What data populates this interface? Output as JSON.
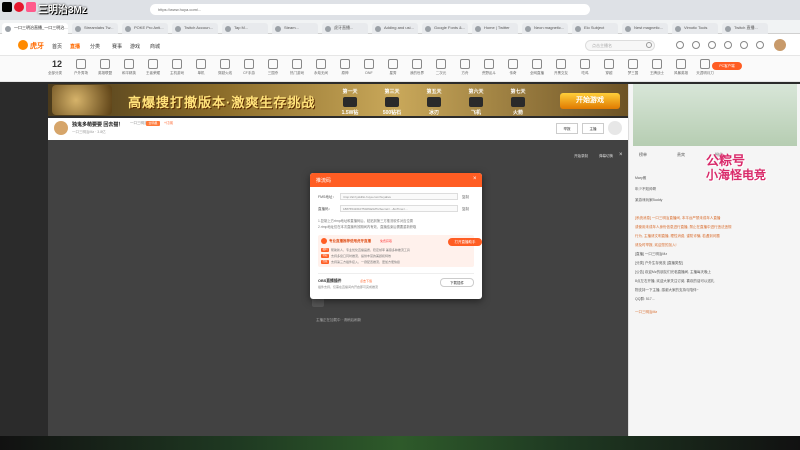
{
  "overlay": {
    "left_title": "三明治3Mz",
    "right_line1": "公粽号",
    "right_line2": "小海怪电竞"
  },
  "browser": {
    "address": "https://www.huya.com/...",
    "tabs": [
      "Streamlabs Tw...",
      "POKE Pro Anti...",
      "Twitch Accoun...",
      "Tap M...",
      "Steam...",
      "虎牙直播...",
      "Adding and usi...",
      "Google Fonts &...",
      "Home | Twitter",
      "Neon magnetic...",
      "Elo Subject",
      "Nest magnetic...",
      "Vimotic Tools",
      "Twitch 直播..."
    ],
    "active_tab": "一口三明治直播_一口三明治..."
  },
  "site_nav": {
    "logo": "虎牙",
    "links": [
      "首页",
      "直播",
      "分类",
      "赛事",
      "游戏",
      "商城"
    ],
    "search_placeholder": "点击主播名",
    "login": "登录"
  },
  "categories": {
    "count_num": "12",
    "count_label": "全部分类",
    "items": [
      "户外秀场",
      "英雄联盟",
      "和平精英",
      "王者荣耀",
      "主机游戏",
      "单机",
      "穿越火线",
      "CF手游",
      "三国杀",
      "热门游戏",
      "永劫无间",
      "原神",
      "DNF",
      "星秀",
      "我的世界",
      "二次元",
      "方舟",
      "荒野乱斗",
      "传奇",
      "全网直播",
      "开黑交友",
      "吃鸡",
      "穿越",
      "梦三国",
      "王牌战士",
      "风暴英雄",
      "天涯明月刀"
    ],
    "pc_badge": "PC客户端"
  },
  "banner": {
    "title": "高爆搜打撤版本·激爽生存挑战",
    "items": [
      "第一天",
      "第三天",
      "第五天",
      "第六天",
      "第七天"
    ],
    "item_labels": [
      "1.5W钻",
      "500钻石",
      "冰刃",
      "飞机",
      "火箭"
    ],
    "cta": "开始游戏"
  },
  "stream": {
    "title": "独鬼多萌要要 回去猫！",
    "host": "一口三明治Mz",
    "badge": "全明星",
    "follow": "+订阅",
    "meta": "一口三明治Mz  · 3.8亿",
    "btn_report": "举报",
    "btn_subscribe": "主播",
    "video_btn1": "开始录制",
    "video_btn2": "弹幕切换",
    "video_close": "×",
    "bottom_text": "主播正在加载中  · 请稍后刷新"
  },
  "modal": {
    "title": "推流码",
    "fields": [
      {
        "label": "FMS地址：",
        "value": "rtmp://al.hyskillto.huya.com/huyalive",
        "copy": "复制"
      },
      {
        "label": "直播码：",
        "value": "188765416107502f3a9d?txSecret=...&txTime=...",
        "copy": "复制"
      }
    ],
    "notes": [
      "1.复制上方rtmp地址和直播码后，粘贴到第三方推流软件对应位置",
      "2.rtmp地址仅在本次直播有效期间内有效，直播结束后需要重新获取"
    ],
    "promo_title": "专业直播推荐使用虎牙直播",
    "promo_hot": "免费获取",
    "promo_lines": [
      "帮助新人，专业优化直播画质，稳定帧率 兼容多种推流工具",
      "支持多窗口同时推流，提供丰富的美颜和特效",
      "支持第三方插件接入，一键配置推流，更加方便快捷"
    ],
    "tags": [
      "福利",
      "特权",
      "性能"
    ],
    "open_btn": "打开直播助手",
    "plugin_title": "OBS直播插件",
    "plugin_hot": "点击下载",
    "plugin_desc": "插件支持，仅需在直播间内开启即可完成推流",
    "download_btn": "下载插件"
  },
  "right_panel": {
    "tabs": [
      "榜单",
      "贵宾",
      "粉丝"
    ],
    "ranks": [
      "Mary雅",
      "年少不知帅哥",
      "某游戏玩家Buddy"
    ],
    "chat": [
      "[系统消息] 一口三明治直播间, 本平台严禁未成年人直播",
      "或使用未成年人身份信息进行直播, 禁止在直播中进行违法违规",
      "行为, 主播请文明直播, 理性消费, 谨防诈骗, 若遇到问题",
      "请及时举报, 欢迎您的加入!",
      "[直播] 一口三明治Mz",
      "[分类] 户外生存竞技  [直播类型]",
      "[公告] 欢迎Mz的朋友们光临直播间, 主播每天晚上",
      "8点左右开播, 欢迎大家关注订阅, 喜欢的话可以送礼",
      "物支持一下主播, 感谢大家的支持与陪伴~",
      "QQ群: 517..."
    ],
    "last_chat": "一口三明治Mz"
  }
}
